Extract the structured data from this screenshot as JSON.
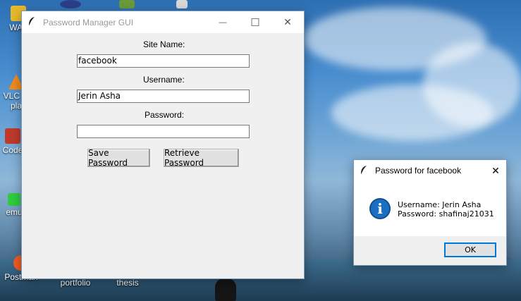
{
  "desktop": {
    "icons": [
      {
        "label": "WAL",
        "color": "#e6b82b"
      },
      {
        "label": "VLC m\npla",
        "color": "#f08a1c"
      },
      {
        "label": "Code",
        "color": "#c0392b"
      },
      {
        "label": "emu",
        "color": "#2ecc40"
      },
      {
        "label": "Postman",
        "color": "#ef5b25"
      },
      {
        "label": "portfolio",
        "color": "#e6b82b"
      },
      {
        "label": "thesis",
        "color": "#e6b82b"
      }
    ]
  },
  "main_window": {
    "title": "Password Manager GUI",
    "minimize_glyph": "—",
    "maximize_glyph": "☐",
    "close_glyph": "✕",
    "site_name_label": "Site Name:",
    "site_name_value": "facebook",
    "username_label": "Username:",
    "username_value": "Jerin Asha",
    "password_label": "Password:",
    "password_value": "",
    "save_button": "Save Password",
    "retrieve_button": "Retrieve Password"
  },
  "dialog": {
    "title": "Password for facebook",
    "close_glyph": "✕",
    "icon_glyph": "i",
    "username_line": "Username: Jerin Asha",
    "password_line": "Password: shafinaj21031",
    "ok_button": "OK"
  },
  "colors": {
    "accent": "#0078d7",
    "info_icon": "#1b6ec2"
  }
}
